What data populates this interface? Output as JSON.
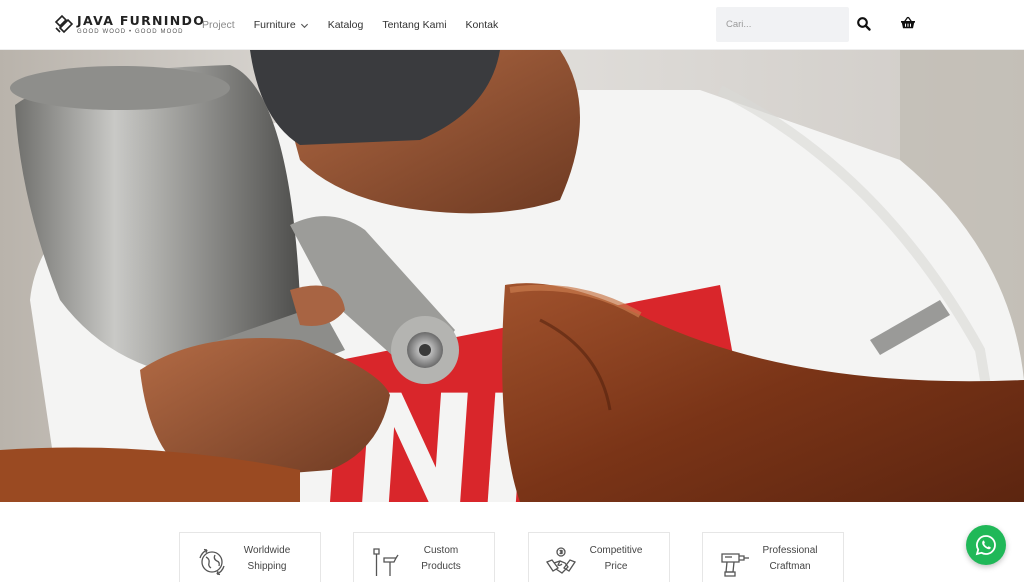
{
  "brand": {
    "name": "JAVA FURNINDO",
    "tagline": "GOOD WOOD • GOOD MOOD"
  },
  "nav": {
    "items": [
      {
        "label": "Project",
        "active": true
      },
      {
        "label": "Furniture",
        "has_dropdown": true
      },
      {
        "label": "Katalog"
      },
      {
        "label": "Tentang Kami"
      },
      {
        "label": "Kontak"
      }
    ]
  },
  "search": {
    "placeholder": "Cari...",
    "value": ""
  },
  "icons": {
    "search": "search-icon",
    "cart": "shopping-basket-icon",
    "whatsapp": "whatsapp-icon"
  },
  "hero": {
    "image": "craftsman-spray-painting-wooden-bowl"
  },
  "features": [
    {
      "label": "Worldwide\nShipping",
      "icon": "globe-shipping-icon"
    },
    {
      "label": "Custom\nProducts",
      "icon": "tools-icon"
    },
    {
      "label": "Competitive\nPrice",
      "icon": "handshake-dollar-icon"
    },
    {
      "label": "Professional\nCraftman",
      "icon": "power-drill-icon"
    }
  ],
  "colors": {
    "whatsapp": "#20b858",
    "nav_active": "#8a8a8a",
    "shirt_red": "#d9262b",
    "wood": "#8a3d1c"
  }
}
